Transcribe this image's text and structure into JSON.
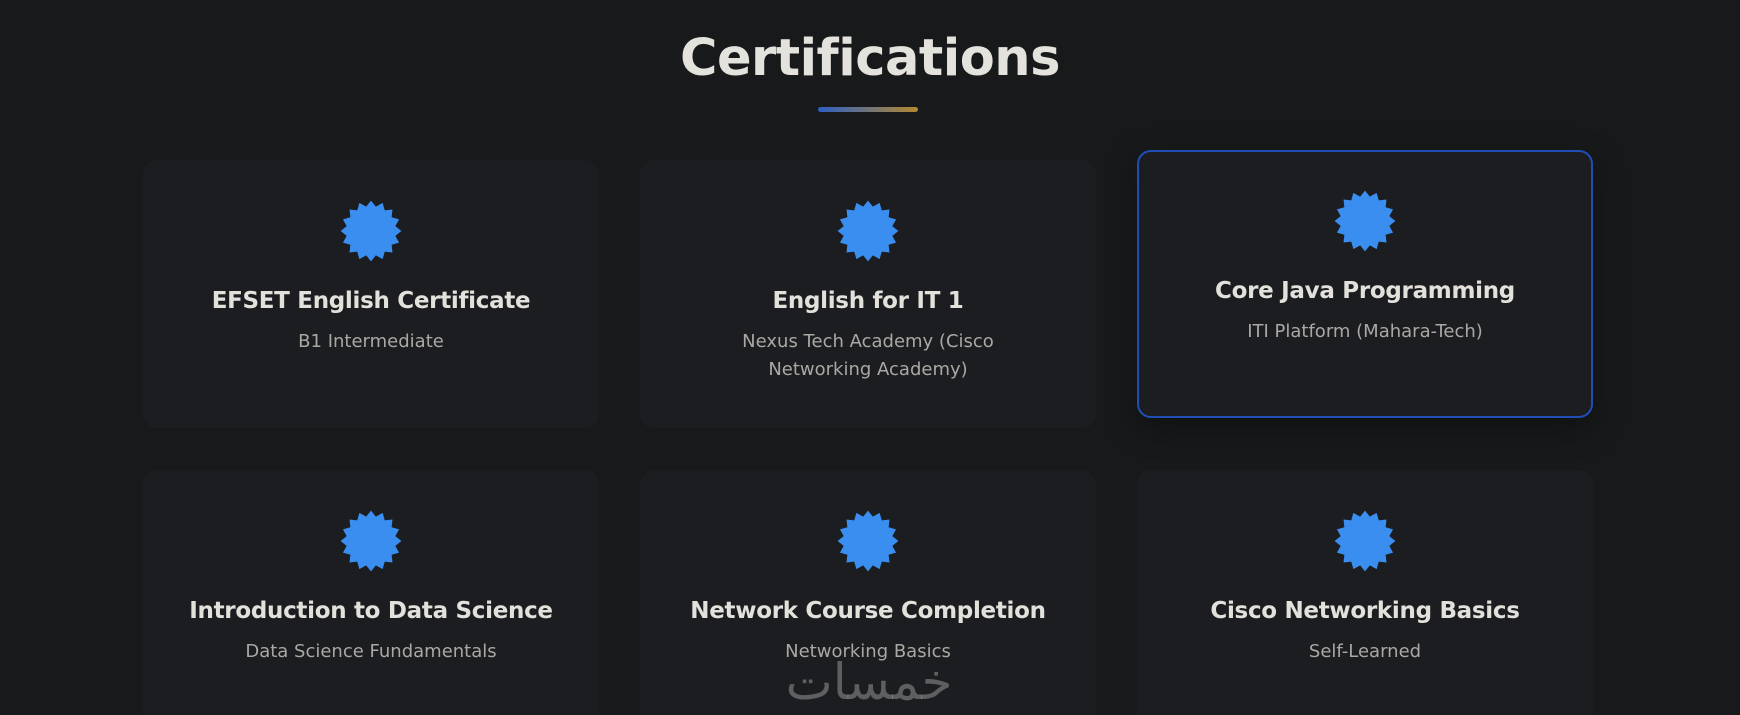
{
  "section": {
    "title": "Certifications"
  },
  "colors": {
    "background": "#18191b",
    "card": "#1c1d20",
    "badge": "#3a8ef0",
    "active_border": "#1f4fb5",
    "underline_start": "#2d5fc4",
    "underline_end": "#b4892e"
  },
  "icons": {
    "badge": "certificate-badge-icon"
  },
  "certifications": [
    {
      "title": "EFSET English Certificate",
      "issuer": "B1 Intermediate"
    },
    {
      "title": "English for IT 1",
      "issuer": "Nexus Tech Academy (Cisco Networking Academy)"
    },
    {
      "title": "Core Java Programming",
      "issuer": "ITI Platform (Mahara-Tech)"
    },
    {
      "title": "Introduction to Data Science",
      "issuer": "Data Science Fundamentals"
    },
    {
      "title": "Network Course Completion",
      "issuer": "Networking Basics"
    },
    {
      "title": "Cisco Networking Basics",
      "issuer": "Self-Learned"
    }
  ],
  "watermark": "خمسات"
}
